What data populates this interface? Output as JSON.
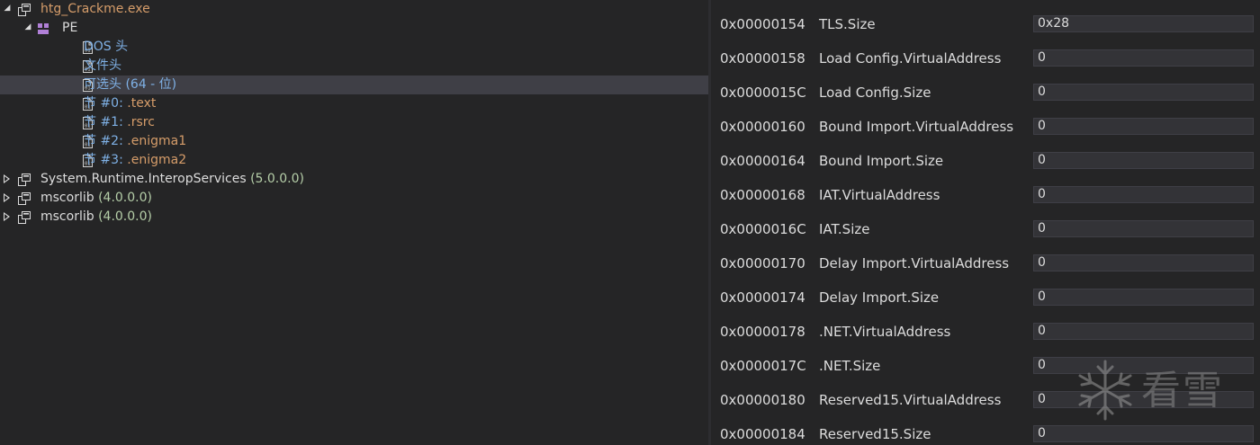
{
  "tree": {
    "items": [
      {
        "label": "htg_Crackme.exe",
        "suffix": "",
        "level": 0,
        "expand": "open",
        "icon": "assembly-icon",
        "color": "orange"
      },
      {
        "label": "PE",
        "suffix": "",
        "level": 1,
        "expand": "open",
        "icon": "pe-module-icon",
        "color": "white"
      },
      {
        "label": "DOS 头",
        "suffix": "",
        "level": 2,
        "expand": "none",
        "icon": "binary-file-icon",
        "color": "blue"
      },
      {
        "label": "文件头",
        "suffix": "",
        "level": 2,
        "expand": "none",
        "icon": "binary-file-icon",
        "color": "blue"
      },
      {
        "label": "可选头",
        "suffix": "  (64 - 位)",
        "level": 2,
        "expand": "none",
        "icon": "binary-file-icon",
        "color": "blue",
        "selected": true
      },
      {
        "label": "节 #0: ",
        "suffix": ".text",
        "level": 2,
        "expand": "none",
        "icon": "binary-file-icon",
        "color": "blue",
        "suffix_color": "orange"
      },
      {
        "label": "节 #1: ",
        "suffix": ".rsrc",
        "level": 2,
        "expand": "none",
        "icon": "binary-file-icon",
        "color": "blue",
        "suffix_color": "orange"
      },
      {
        "label": "节 #2: ",
        "suffix": ".enigma1",
        "level": 2,
        "expand": "none",
        "icon": "binary-file-icon",
        "color": "blue",
        "suffix_color": "orange"
      },
      {
        "label": "节 #3: ",
        "suffix": ".enigma2",
        "level": 2,
        "expand": "none",
        "icon": "binary-file-icon",
        "color": "blue",
        "suffix_color": "orange"
      },
      {
        "label": "System.Runtime.InteropServices ",
        "suffix": "(5.0.0.0)",
        "level": 0,
        "expand": "closed",
        "icon": "assembly-icon",
        "color": "white",
        "suffix_color": "green"
      },
      {
        "label": "mscorlib ",
        "suffix": "(4.0.0.0)",
        "level": 0,
        "expand": "closed",
        "icon": "assembly-icon",
        "color": "white",
        "suffix_color": "green"
      },
      {
        "label": "mscorlib ",
        "suffix": "(4.0.0.0)",
        "level": 0,
        "expand": "closed",
        "icon": "assembly-icon",
        "color": "white",
        "suffix_color": "green"
      }
    ]
  },
  "grid": {
    "rows": [
      {
        "offset": "0x00000154",
        "name": "TLS.Size",
        "value": "0x28"
      },
      {
        "offset": "0x00000158",
        "name": "Load Config.VirtualAddress",
        "value": "0"
      },
      {
        "offset": "0x0000015C",
        "name": "Load Config.Size",
        "value": "0"
      },
      {
        "offset": "0x00000160",
        "name": "Bound Import.VirtualAddress",
        "value": "0"
      },
      {
        "offset": "0x00000164",
        "name": "Bound Import.Size",
        "value": "0"
      },
      {
        "offset": "0x00000168",
        "name": "IAT.VirtualAddress",
        "value": "0"
      },
      {
        "offset": "0x0000016C",
        "name": "IAT.Size",
        "value": "0"
      },
      {
        "offset": "0x00000170",
        "name": "Delay Import.VirtualAddress",
        "value": "0"
      },
      {
        "offset": "0x00000174",
        "name": "Delay Import.Size",
        "value": "0"
      },
      {
        "offset": "0x00000178",
        "name": ".NET.VirtualAddress",
        "value": "0"
      },
      {
        "offset": "0x0000017C",
        "name": ".NET.Size",
        "value": "0"
      },
      {
        "offset": "0x00000180",
        "name": "Reserved15.VirtualAddress",
        "value": "0"
      },
      {
        "offset": "0x00000184",
        "name": "Reserved15.Size",
        "value": "0"
      }
    ]
  },
  "watermark": {
    "text": "看雪",
    "icon": "snowflake-logo-icon"
  },
  "colors": {
    "background": "#252526",
    "selection": "#3f3f46",
    "orange": "#d69d6a",
    "blue": "#7fb1e6",
    "green": "#b5cea8",
    "text": "#dcdcdc"
  }
}
